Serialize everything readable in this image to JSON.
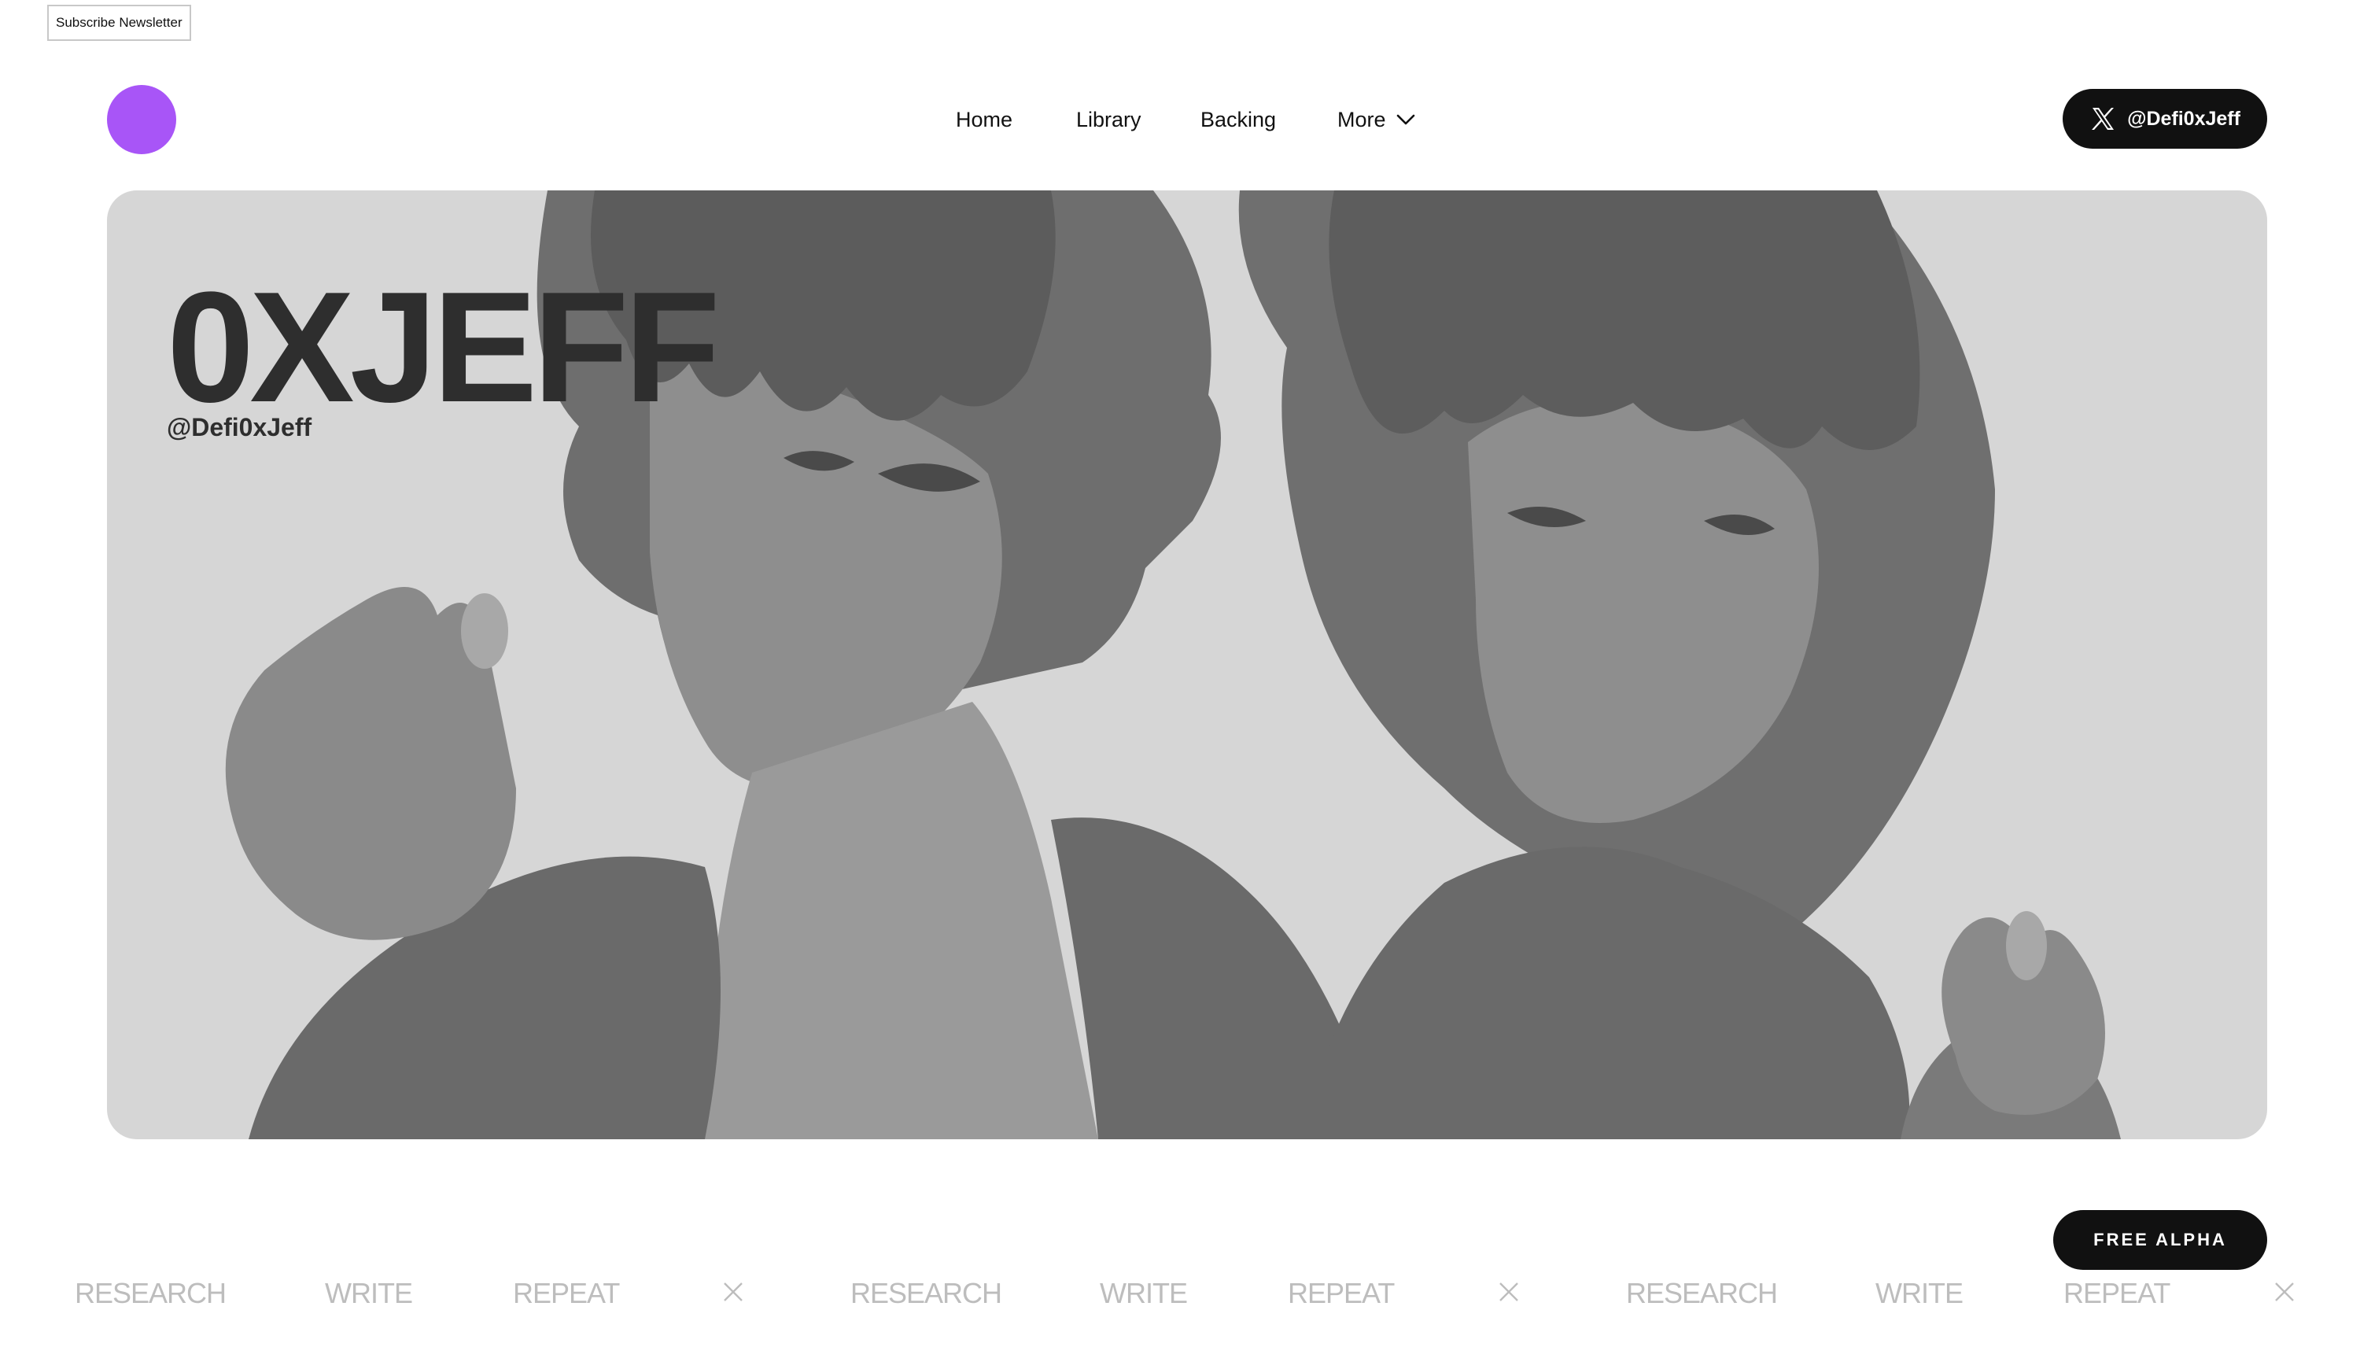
{
  "subscribe": {
    "label": "Subscribe Newsletter"
  },
  "logo": {
    "color": "#a855f7"
  },
  "nav": {
    "items": [
      {
        "label": "Home"
      },
      {
        "label": "Library"
      },
      {
        "label": "Backing"
      },
      {
        "label": "More",
        "icon": "chevron-down-icon"
      }
    ]
  },
  "header": {
    "x_handle": "@Defi0xJeff",
    "x_icon": "x-logo-icon"
  },
  "hero": {
    "title": "0XJEFF",
    "handle": "@Defi0xJeff",
    "image": "anime-illustration-two-characters-holding-pills"
  },
  "cta": {
    "free_alpha_label": "FREE ALPHA"
  },
  "marquee": {
    "words": [
      "RESEARCH",
      "WRITE",
      "REPEAT",
      "RESEARCH",
      "WRITE",
      "REPEAT",
      "RESEARCH",
      "WRITE",
      "REPEAT"
    ],
    "separator_icon": "close-icon",
    "text_color": "#bdbdbd"
  }
}
